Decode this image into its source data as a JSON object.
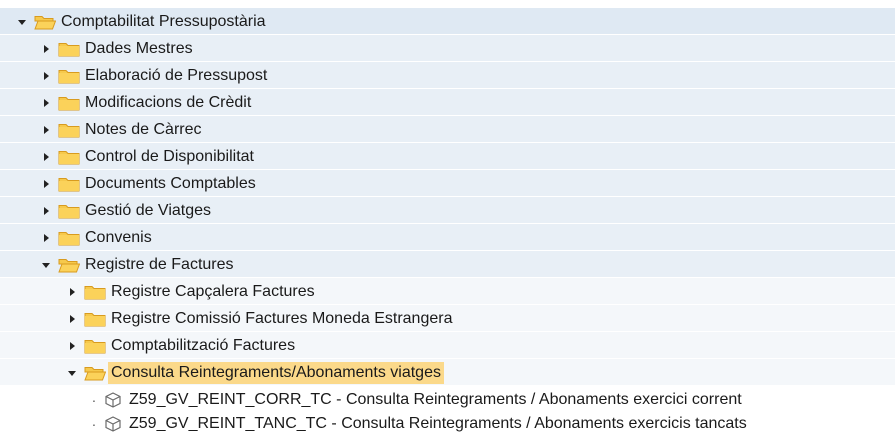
{
  "tree": {
    "root": {
      "label": "Comptabilitat Pressupostària",
      "expanded": true
    },
    "level1": [
      {
        "label": "Dades Mestres",
        "expanded": false
      },
      {
        "label": "Elaboració de Pressupost",
        "expanded": false
      },
      {
        "label": "Modificacions de Crèdit",
        "expanded": false
      },
      {
        "label": "Notes de Càrrec",
        "expanded": false
      },
      {
        "label": "Control de Disponibilitat",
        "expanded": false
      },
      {
        "label": "Documents Comptables",
        "expanded": false
      },
      {
        "label": "Gestió de Viatges",
        "expanded": false
      },
      {
        "label": "Convenis",
        "expanded": false
      },
      {
        "label": "Registre de Factures",
        "expanded": true
      }
    ],
    "level2": [
      {
        "label": "Registre Capçalera Factures",
        "expanded": false
      },
      {
        "label": "Registre Comissió Factures Moneda Estrangera",
        "expanded": false
      },
      {
        "label": "Comptabilització Factures",
        "expanded": false
      },
      {
        "label": "Consulta Reintegraments/Abonaments viatges",
        "expanded": true,
        "selected": true
      }
    ],
    "level3": [
      {
        "label": "Z59_GV_REINT_CORR_TC - Consulta Reintegraments / Abonaments exercici corrent"
      },
      {
        "label": "Z59_GV_REINT_TANC_TC - Consulta Reintegraments / Abonaments exercicis tancats"
      }
    ]
  },
  "colors": {
    "folder_fill": "#f6c94c",
    "folder_edge": "#d89b1f",
    "selection": "#fbd98a",
    "band_root": "#dfe9f3",
    "band_level1": "#e8eff6",
    "band_level2": "#f4f7fa"
  }
}
